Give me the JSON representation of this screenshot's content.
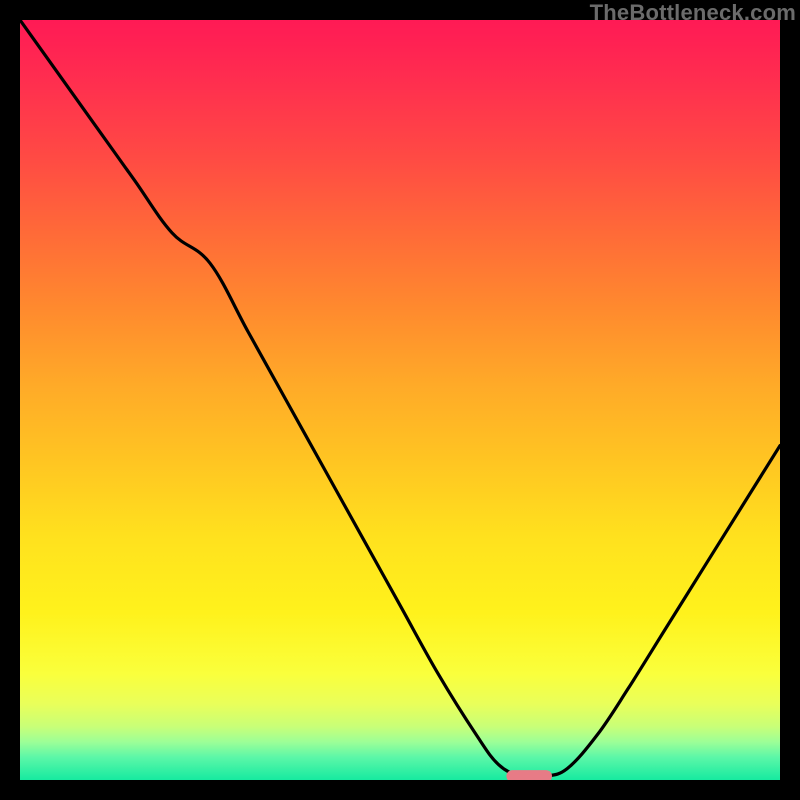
{
  "watermark": "TheBottleneck.com",
  "chart_data": {
    "type": "line",
    "title": "",
    "xlabel": "",
    "ylabel": "",
    "xlim": [
      0,
      100
    ],
    "ylim": [
      0,
      100
    ],
    "x": [
      0,
      5,
      10,
      15,
      20,
      25,
      30,
      35,
      40,
      45,
      50,
      55,
      60,
      63,
      66,
      69,
      72,
      76,
      80,
      85,
      90,
      95,
      100
    ],
    "values": [
      100,
      93,
      86,
      79,
      72,
      68,
      59,
      50,
      41,
      32,
      23,
      14,
      6,
      2,
      0.5,
      0.5,
      1.5,
      6,
      12,
      20,
      28,
      36,
      44
    ],
    "marker": {
      "x_center": 67,
      "y": 0.5,
      "width": 6,
      "height": 1.6
    },
    "colors": {
      "curve": "#000000",
      "marker": "#e77b86",
      "gradient_top": "#ff1a55",
      "gradient_bottom": "#16eaa0"
    }
  }
}
